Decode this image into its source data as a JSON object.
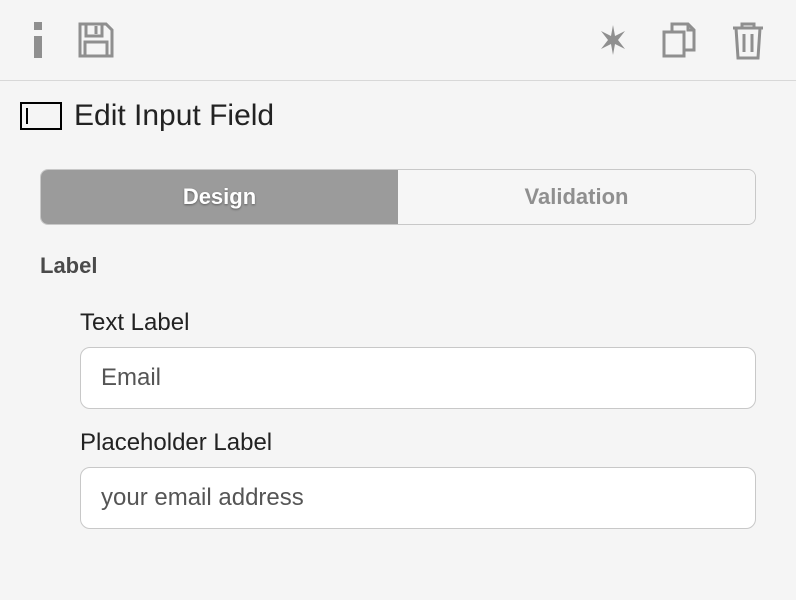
{
  "title": "Edit Input Field",
  "tabs": {
    "design": "Design",
    "validation": "Validation"
  },
  "section": {
    "label": "Label"
  },
  "fields": {
    "textLabel": {
      "label": "Text Label",
      "value": "Email"
    },
    "placeholderLabel": {
      "label": "Placeholder Label",
      "value": "your email address"
    }
  }
}
